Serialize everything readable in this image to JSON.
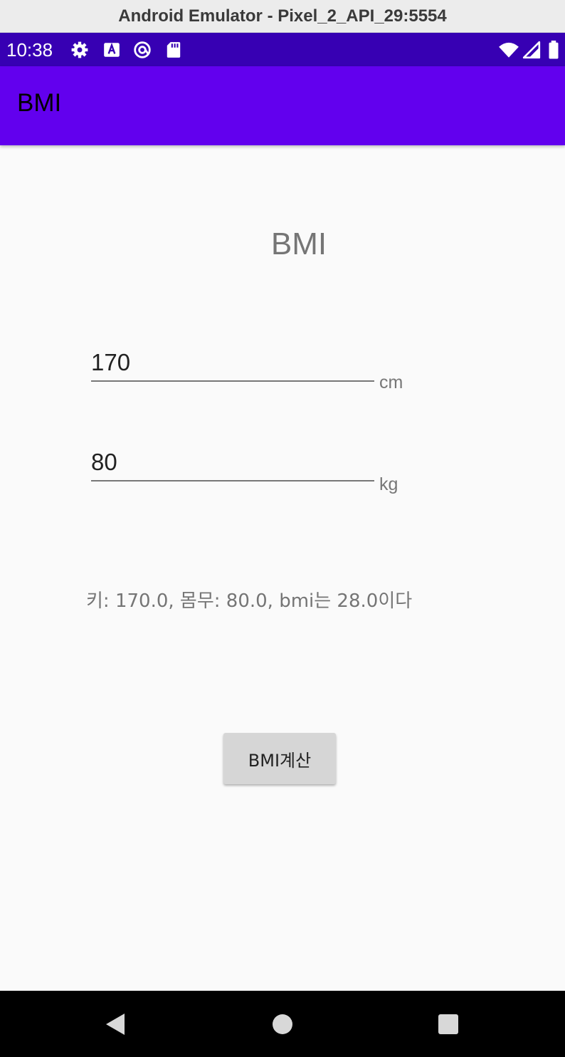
{
  "window": {
    "title": "Android Emulator - Pixel_2_API_29:5554"
  },
  "status_bar": {
    "time": "10:38",
    "left_icons": [
      "gear-icon",
      "a-box-icon",
      "at-circle-icon",
      "sd-card-icon"
    ],
    "right_icons": [
      "wifi-icon",
      "signal-icon",
      "battery-icon"
    ]
  },
  "app_bar": {
    "title": "BMI"
  },
  "main": {
    "heading": "BMI",
    "height_field": {
      "value": "170",
      "unit": "cm"
    },
    "weight_field": {
      "value": "80",
      "unit": "kg"
    },
    "result_text": "키: 170.0, 몸무: 80.0, bmi는 28.0이다",
    "calc_button_label": "BMI계산"
  },
  "nav_bar": {
    "buttons": [
      "back-icon",
      "home-icon",
      "recents-icon"
    ]
  },
  "colors": {
    "status_bar": "#3700b3",
    "app_bar": "#6200ee",
    "background": "#fafafa",
    "button": "#d6d6d6"
  }
}
